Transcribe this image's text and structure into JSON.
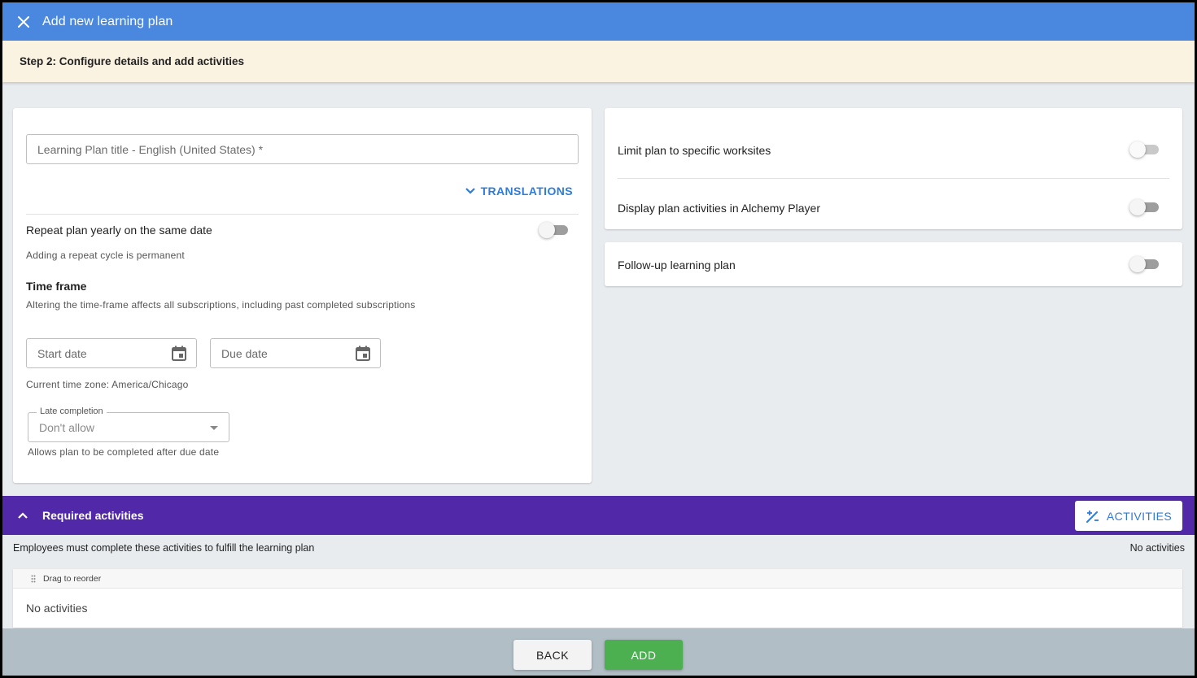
{
  "header": {
    "title": "Add new learning plan"
  },
  "step": {
    "text": "Step 2: Configure details and add activities"
  },
  "details": {
    "title_placeholder": "Learning Plan title - English (United States) *",
    "translations_label": "TRANSLATIONS",
    "repeat_label": "Repeat plan yearly on the same date",
    "repeat_helper": "Adding a repeat cycle is permanent",
    "timeframe_heading": "Time frame",
    "timeframe_helper": "Altering the time-frame affects all subscriptions, including past completed subscriptions",
    "start_date_placeholder": "Start date",
    "due_date_placeholder": "Due date",
    "timezone_text": "Current time zone: America/Chicago",
    "late_completion_label": "Late completion",
    "late_completion_value": "Don't allow",
    "late_completion_helper": "Allows plan to be completed after due date"
  },
  "settings": {
    "limit_worksites_label": "Limit plan to specific worksites",
    "display_alchemy_label": "Display plan activities in Alchemy Player",
    "followup_label": "Follow-up learning plan"
  },
  "required": {
    "title": "Required activities",
    "activities_button": "ACTIVITIES",
    "description": "Employees must complete these activities to fulfill the learning plan",
    "count_text": "No activities",
    "drag_label": "Drag to reorder",
    "empty_text": "No activities"
  },
  "footer": {
    "back_label": "BACK",
    "add_label": "ADD"
  },
  "colors": {
    "header": "#4a88e0",
    "step_bg": "#fbf3e1",
    "required_bar": "#5028a8",
    "accent_link": "#2f7bd8",
    "add_button": "#4caf50",
    "footer_bg": "#b1bec5"
  }
}
